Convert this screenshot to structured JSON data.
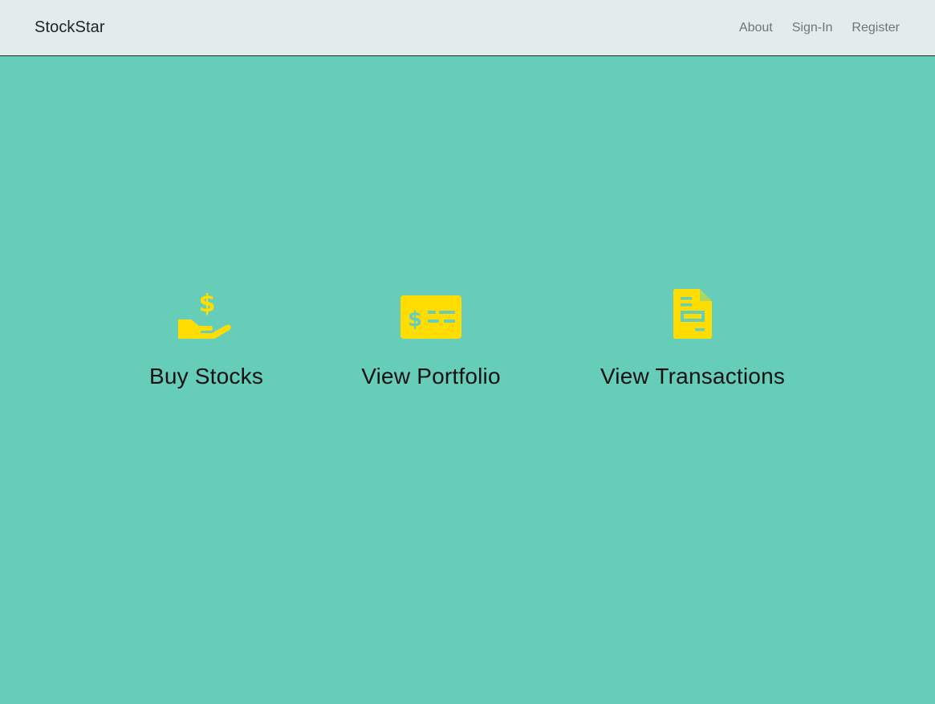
{
  "navbar": {
    "brand": "StockStar",
    "links": [
      {
        "label": "About"
      },
      {
        "label": "Sign-In"
      },
      {
        "label": "Register"
      }
    ]
  },
  "tiles": [
    {
      "label": "Buy Stocks",
      "icon": "hand-holding-dollar-icon"
    },
    {
      "label": "View Portfolio",
      "icon": "money-check-dollar-icon"
    },
    {
      "label": "View Transactions",
      "icon": "receipt-document-icon"
    }
  ],
  "colors": {
    "background": "#66CDB8",
    "navbar": "#E2ECEA",
    "icon": "#FFDD00",
    "text": "#111111"
  }
}
